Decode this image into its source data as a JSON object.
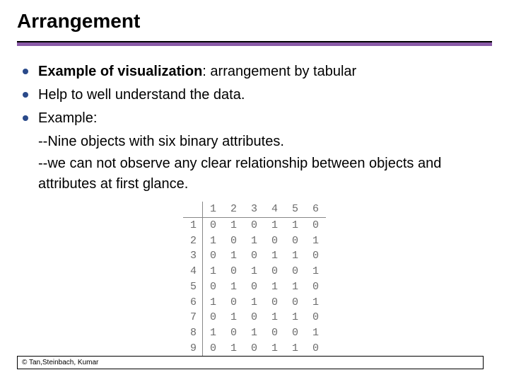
{
  "title": "Arrangement",
  "bullets": [
    {
      "prefix": "Example of visualization",
      "rest": ": arrangement by tabular"
    },
    {
      "text": "Help to well understand the data."
    },
    {
      "text": "Example:"
    }
  ],
  "sublines": [
    "--Nine objects with six binary attributes.",
    "--we can not observe any clear relationship between objects and attributes at first glance."
  ],
  "chart_data": {
    "type": "table",
    "columns": [
      "1",
      "2",
      "3",
      "4",
      "5",
      "6"
    ],
    "rows": [
      "1",
      "2",
      "3",
      "4",
      "5",
      "6",
      "7",
      "8",
      "9"
    ],
    "values": [
      [
        0,
        1,
        0,
        1,
        1,
        0
      ],
      [
        1,
        0,
        1,
        0,
        0,
        1
      ],
      [
        0,
        1,
        0,
        1,
        1,
        0
      ],
      [
        1,
        0,
        1,
        0,
        0,
        1
      ],
      [
        0,
        1,
        0,
        1,
        1,
        0
      ],
      [
        1,
        0,
        1,
        0,
        0,
        1
      ],
      [
        0,
        1,
        0,
        1,
        1,
        0
      ],
      [
        1,
        0,
        1,
        0,
        0,
        1
      ],
      [
        0,
        1,
        0,
        1,
        1,
        0
      ]
    ]
  },
  "footer": "© Tan,Steinbach, Kumar"
}
